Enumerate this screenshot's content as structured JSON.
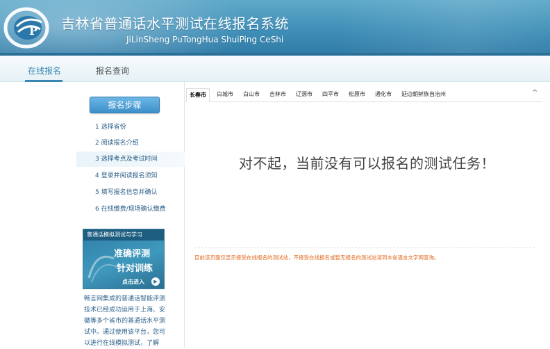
{
  "header": {
    "title_cn": "吉林省普通话水平测试在线报名系统",
    "title_en": "JiLinSheng PuTongHua ShuiPing CeShi",
    "logo_icon": "logo-emblem-icon",
    "bg_color": "#4a9cc4"
  },
  "nav": {
    "items": [
      {
        "label": "在线报名",
        "active": true
      },
      {
        "label": "报名查询",
        "active": false
      }
    ],
    "accent_color": "#3a86b5"
  },
  "sidebar": {
    "steps_button": "报名步骤",
    "steps": [
      {
        "label": "1 选择省份"
      },
      {
        "label": "2 阅读报名介绍"
      },
      {
        "label": "3 选择考点及考试时间"
      },
      {
        "label": "4 登录并阅读报名须知"
      },
      {
        "label": "5 填写报名信息并确认"
      },
      {
        "label": "6 在线缴费/现场确认缴费"
      }
    ],
    "promo": {
      "top": "普通话模拟测试与学习",
      "line1": "准确评测",
      "line2": "针对训练",
      "enter": "点击进入"
    },
    "description": "畅言网集成的普通话智能评测技术已经成功运用于上海、安徽等多个省市的普通话水平测试中。通过使用该平台，您可以进行在线模拟测试，了解"
  },
  "main": {
    "cities": [
      "长春市",
      "白城市",
      "白山市",
      "吉林市",
      "辽源市",
      "四平市",
      "松原市",
      "通化市",
      "延边朝鲜族自治州"
    ],
    "active_city": "长春市",
    "caret_icon": "caret-up-icon",
    "message": "对不起，当前没有可以报名的测试任务！",
    "notice": "目前该页面仅显示接受在线报名的测试站，不接受在线报名或暂无报名的测试站请到本省语言文字网查询。",
    "notice_color": "#e2691f"
  }
}
